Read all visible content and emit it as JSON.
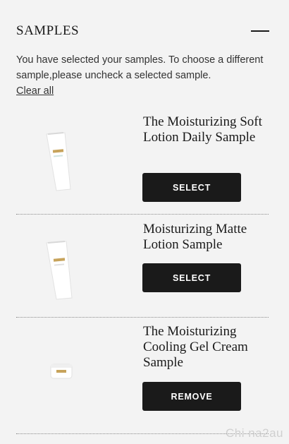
{
  "panel": {
    "title": "SAMPLES",
    "intro_text": "You have selected your samples. To choose a different sample,please uncheck a selected sample.",
    "clear_label": "Clear all"
  },
  "items": [
    {
      "name": "The Moisturizing Soft Lotion Daily Sample",
      "button_label": "SELECT",
      "image": "lotion-tube"
    },
    {
      "name": "Moisturizing Matte Lotion Sample",
      "button_label": "SELECT",
      "image": "lotion-tube"
    },
    {
      "name": "The Moisturizing Cooling Gel Cream Sample",
      "button_label": "REMOVE",
      "image": "cream-jar"
    }
  ],
  "watermark": "Chi na2au"
}
